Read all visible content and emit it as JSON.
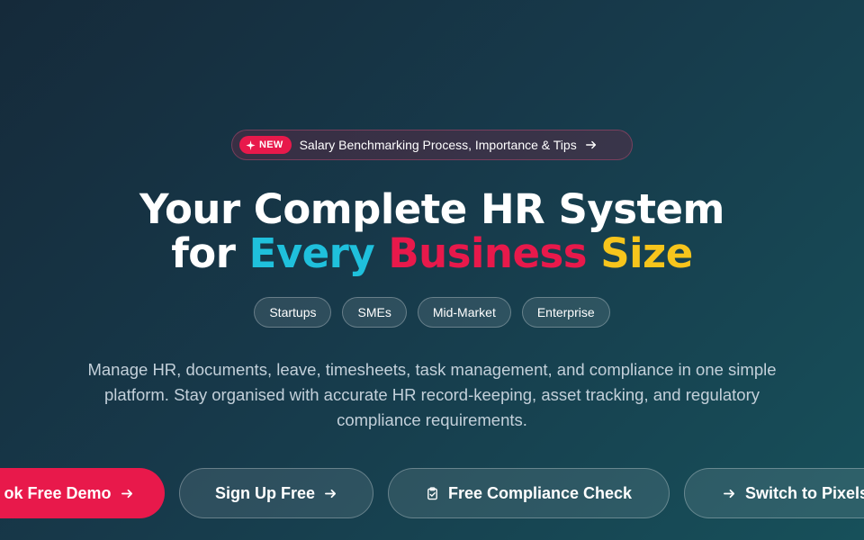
{
  "announcement": {
    "badge_label": "NEW",
    "badge_icon": "sparkle-icon",
    "text": "Salary Benchmarking Process, Importance & Tips",
    "arrow_icon": "arrow-right-icon"
  },
  "headline": {
    "line1": "Your Complete HR System",
    "line2_prefix": "for ",
    "word_every": "Every",
    "word_business": "Business",
    "word_size": "Size"
  },
  "segments": [
    "Startups",
    "SMEs",
    "Mid-Market",
    "Enterprise"
  ],
  "description": "Manage HR, documents, leave, timesheets, task management, and compliance in one simple platform. Stay organised with accurate HR record-keeping, asset tracking, and regulatory compliance requirements.",
  "cta": {
    "demo_label": "ok Free Demo",
    "signup_label": "Sign Up Free",
    "compliance_label": "Free Compliance Check",
    "switch_label": "Switch to Pixels"
  },
  "colors": {
    "accent_red": "#e8194b",
    "accent_cyan": "#1fc0dc",
    "accent_yellow": "#f7c51c"
  }
}
